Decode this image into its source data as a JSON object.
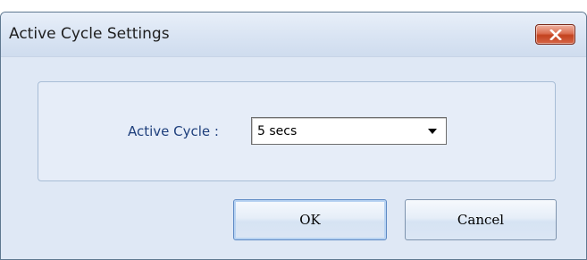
{
  "window": {
    "title": "Active Cycle Settings",
    "close_icon": "close-x-icon"
  },
  "settings": {
    "active_cycle_label": "Active Cycle :",
    "active_cycle_value": "5 secs",
    "dropdown_icon": "chevron-down-icon"
  },
  "buttons": {
    "ok_label": "OK",
    "cancel_label": "Cancel"
  },
  "colors": {
    "dialog_background": "#dfe8f5",
    "label_text": "#1e3f7c",
    "close_button": "#c3421f"
  }
}
